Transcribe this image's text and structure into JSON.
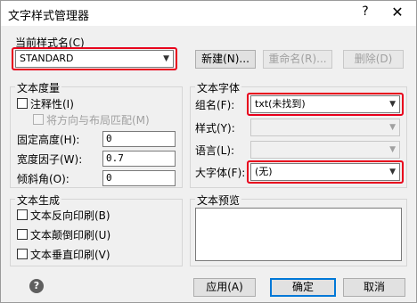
{
  "window": {
    "title": "文字样式管理器",
    "help_glyph": "?",
    "close_glyph": "✕"
  },
  "current_style": {
    "label": "当前样式名(C)",
    "value": "STANDARD",
    "buttons": {
      "new": "新建(N)...",
      "rename": "重命名(R)...",
      "delete": "删除(D)"
    }
  },
  "text_measure": {
    "label": "文本度量",
    "annotative": "注释性(I)",
    "match_orientation": "将方向与布局匹配(M)",
    "fixed_height": {
      "label": "固定高度(H):",
      "value": "0"
    },
    "width_factor": {
      "label": "宽度因子(W):",
      "value": "0.7"
    },
    "oblique_angle": {
      "label": "倾斜角(O):",
      "value": "0"
    }
  },
  "text_font": {
    "label": "文本字体",
    "font_name": {
      "label": "组名(F):",
      "value": "txt(未找到)"
    },
    "font_style": {
      "label": "样式(Y):",
      "value": ""
    },
    "language": {
      "label": "语言(L):",
      "value": ""
    },
    "big_font": {
      "label": "大字体(F):",
      "value": "(无)"
    }
  },
  "text_generation": {
    "label": "文本生成",
    "backwards": "文本反向印刷(B)",
    "upside_down": "文本颠倒印刷(U)",
    "vertical": "文本垂直印刷(V)"
  },
  "text_preview": {
    "label": "文本预览"
  },
  "footer": {
    "apply": "应用(A)",
    "ok": "确定",
    "cancel": "取消",
    "help_glyph": "?"
  }
}
